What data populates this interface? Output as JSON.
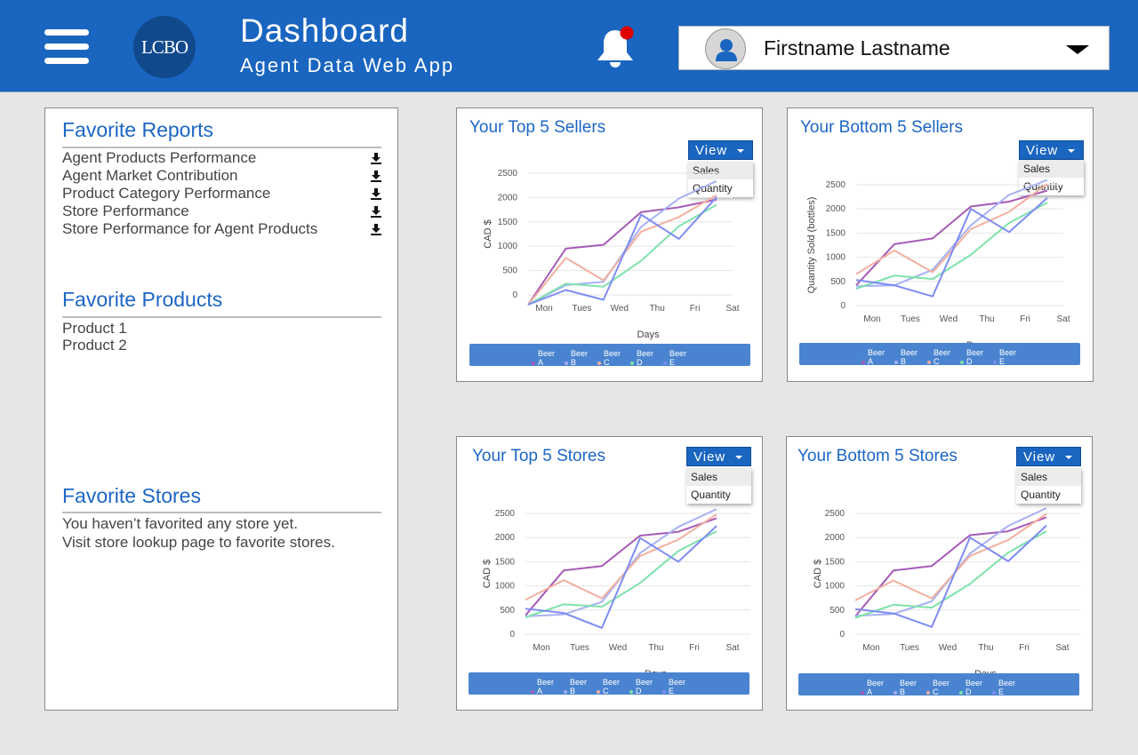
{
  "header": {
    "title": "Dashboard",
    "subtitle": "Agent Data Web App",
    "logo_text": "LCBO",
    "user_name": "Firstname Lastname",
    "notification_dot_color": "#e00000",
    "accent_color": "#1965c0"
  },
  "favorite_reports": {
    "title": "Favorite Reports",
    "items": [
      "Agent Products Performance",
      "Agent Market Contribution",
      "Product Category Performance",
      "Store Performance",
      "Store Performance for Agent Products"
    ]
  },
  "favorite_products": {
    "title": "Favorite Products",
    "items": [
      "Product 1",
      "Product 2"
    ]
  },
  "favorite_stores": {
    "title": "Favorite Stores",
    "line1": "You haven’t favorited any store yet.",
    "line2": "Visit store lookup page to favorite stores."
  },
  "view_menu": {
    "label": "View",
    "options": [
      "Sales",
      "Quantity"
    ]
  },
  "cards": [
    {
      "title": "Your Top 5 Sellers"
    },
    {
      "title": "Your Bottom 5 Sellers"
    },
    {
      "title": "Your Top 5 Stores"
    },
    {
      "title": "Your Bottom 5 Stores"
    }
  ],
  "chart_data": [
    {
      "type": "line",
      "title": "Your Top 5 Sellers",
      "xlabel": "Days",
      "ylabel": "CAD $",
      "categories": [
        "Mon",
        "Tues",
        "Wed",
        "Thu",
        "Fri",
        "Sat"
      ],
      "ylim": [
        0,
        2500
      ],
      "yticks": [
        0,
        500,
        1000,
        1500,
        2000,
        2500
      ],
      "grid": true,
      "legend_position": "bottom",
      "series": [
        {
          "name": "Beer A",
          "color": "#a65bb6",
          "values": [
            -200,
            950,
            1030,
            1700,
            1800,
            1960
          ]
        },
        {
          "name": "Beer B",
          "color": "#a7b1f2",
          "values": [
            -200,
            200,
            270,
            1400,
            1980,
            2340
          ]
        },
        {
          "name": "Beer C",
          "color": "#f2b0a0",
          "values": [
            -200,
            760,
            300,
            1300,
            1600,
            2050
          ]
        },
        {
          "name": "Beer D",
          "color": "#7ee2ab",
          "values": [
            -200,
            230,
            170,
            700,
            1410,
            1850
          ]
        },
        {
          "name": "Beer E",
          "color": "#7f8cf2",
          "values": [
            -200,
            100,
            -100,
            1650,
            1150,
            2010
          ]
        }
      ]
    },
    {
      "type": "line",
      "title": "Your Bottom 5 Sellers",
      "xlabel": "Days",
      "ylabel": "Quantity Sold (bottles)",
      "categories": [
        "Mon",
        "Tues",
        "Wed",
        "Thu",
        "Fri",
        "Sat"
      ],
      "ylim": [
        0,
        2500
      ],
      "yticks": [
        0,
        500,
        1000,
        1500,
        2000,
        2500
      ],
      "grid": true,
      "legend_position": "bottom",
      "series": [
        {
          "name": "Beer A",
          "color": "#a65bb6",
          "values": [
            420,
            1270,
            1390,
            2050,
            2150,
            2380
          ]
        },
        {
          "name": "Beer B",
          "color": "#a7b1f2",
          "values": [
            400,
            420,
            740,
            1660,
            2290,
            2600
          ]
        },
        {
          "name": "Beer C",
          "color": "#f2b0a0",
          "values": [
            650,
            1140,
            690,
            1580,
            1940,
            2520
          ]
        },
        {
          "name": "Beer D",
          "color": "#7ee2ab",
          "values": [
            350,
            620,
            550,
            1050,
            1710,
            2130
          ]
        },
        {
          "name": "Beer E",
          "color": "#7f8cf2",
          "values": [
            530,
            420,
            190,
            2000,
            1520,
            2230
          ]
        }
      ]
    },
    {
      "type": "line",
      "title": "Your Top 5 Stores",
      "xlabel": "Days",
      "ylabel": "CAD $",
      "categories": [
        "Mon",
        "Tues",
        "Wed",
        "Thu",
        "Fri",
        "Sat"
      ],
      "ylim": [
        0,
        2500
      ],
      "yticks": [
        0,
        500,
        1000,
        1500,
        2000,
        2500
      ],
      "grid": true,
      "legend_position": "bottom",
      "series": [
        {
          "name": "Beer A",
          "color": "#a65bb6",
          "values": [
            390,
            1320,
            1410,
            2040,
            2120,
            2400
          ]
        },
        {
          "name": "Beer B",
          "color": "#a7b1f2",
          "values": [
            370,
            410,
            670,
            1680,
            2220,
            2590
          ]
        },
        {
          "name": "Beer C",
          "color": "#f2b0a0",
          "values": [
            710,
            1120,
            740,
            1620,
            1960,
            2480
          ]
        },
        {
          "name": "Beer D",
          "color": "#7ee2ab",
          "values": [
            350,
            620,
            570,
            1060,
            1720,
            2130
          ]
        },
        {
          "name": "Beer E",
          "color": "#7f8cf2",
          "values": [
            530,
            440,
            130,
            1990,
            1500,
            2240
          ]
        }
      ]
    },
    {
      "type": "line",
      "title": "Your Bottom 5 Stores",
      "xlabel": "Days",
      "ylabel": "CAD $",
      "categories": [
        "Mon",
        "Tues",
        "Wed",
        "Thu",
        "Fri",
        "Sat"
      ],
      "ylim": [
        0,
        2500
      ],
      "yticks": [
        0,
        500,
        1000,
        1500,
        2000,
        2500
      ],
      "grid": true,
      "legend_position": "bottom",
      "series": [
        {
          "name": "Beer A",
          "color": "#a65bb6",
          "values": [
            370,
            1320,
            1410,
            2050,
            2130,
            2420
          ]
        },
        {
          "name": "Beer B",
          "color": "#a7b1f2",
          "values": [
            380,
            420,
            680,
            1670,
            2240,
            2610
          ]
        },
        {
          "name": "Beer C",
          "color": "#f2b0a0",
          "values": [
            700,
            1110,
            740,
            1620,
            1950,
            2490
          ]
        },
        {
          "name": "Beer D",
          "color": "#7ee2ab",
          "values": [
            340,
            610,
            550,
            1040,
            1690,
            2130
          ]
        },
        {
          "name": "Beer E",
          "color": "#7f8cf2",
          "values": [
            520,
            430,
            150,
            2000,
            1510,
            2250
          ]
        }
      ]
    }
  ]
}
